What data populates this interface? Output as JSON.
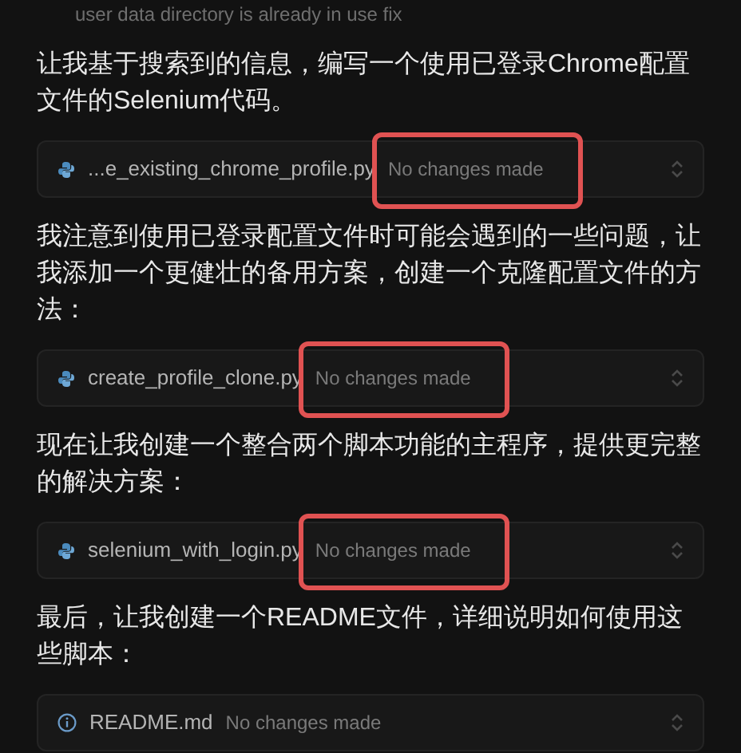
{
  "top_note": "user data directory is already in use fix",
  "blocks": [
    {
      "kind": "paragraph",
      "text": "让我基于搜索到的信息，编写一个使用已登录Chrome配置文件的Selenium代码。"
    },
    {
      "kind": "python_file",
      "name": "...e_existing_chrome_profile.py",
      "status": "No changes made",
      "highlighted": true
    },
    {
      "kind": "paragraph",
      "text": "我注意到使用已登录配置文件时可能会遇到的一些问题，让我添加一个更健壮的备用方案，创建一个克隆配置文件的方法："
    },
    {
      "kind": "python_file",
      "name": "create_profile_clone.py",
      "status": "No changes made",
      "highlighted": true
    },
    {
      "kind": "paragraph",
      "text": "现在让我创建一个整合两个脚本功能的主程序，提供更完整的解决方案："
    },
    {
      "kind": "python_file",
      "name": "selenium_with_login.py",
      "status": "No changes made",
      "highlighted": true
    },
    {
      "kind": "paragraph",
      "text": "最后，让我创建一个README文件，详细说明如何使用这些脚本："
    },
    {
      "kind": "doc_file",
      "name": "README.md",
      "status": "No changes made",
      "highlighted": false
    }
  ]
}
